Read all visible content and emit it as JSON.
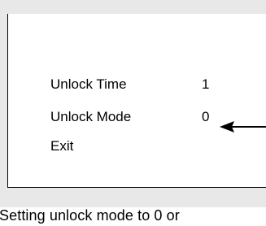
{
  "menu": {
    "items": [
      {
        "label": "Unlock Time",
        "value": "1"
      },
      {
        "label": "Unlock Mode",
        "value": "0"
      },
      {
        "label": "Exit",
        "value": ""
      }
    ]
  },
  "pointer_icon": "left-arrow-icon",
  "caption": "Setting unlock mode to 0 or"
}
